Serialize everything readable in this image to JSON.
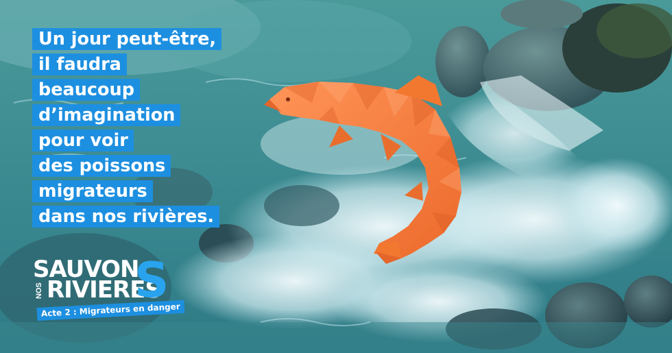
{
  "headline": {
    "lines": [
      "Un jour peut-être,",
      "il faudra",
      "beaucoup",
      "d’imagination",
      "pour voir",
      "des poissons",
      "migrateurs",
      "dans nos rivières."
    ]
  },
  "logo": {
    "word_top": "SAUVON",
    "word_small": "NOS",
    "word_bottom": "RIVIERES",
    "big_letter": "S",
    "tagline": "Acte 2 : Migrateurs en danger"
  },
  "colors": {
    "banner_blue": "#1d8fe0",
    "logo_accent": "#29a3ee",
    "fish_orange": "#f47b3c",
    "water_teal": "#3f8a8c"
  },
  "icons": {
    "fish": "origami-salmon",
    "background": "river-rapids-photo"
  }
}
